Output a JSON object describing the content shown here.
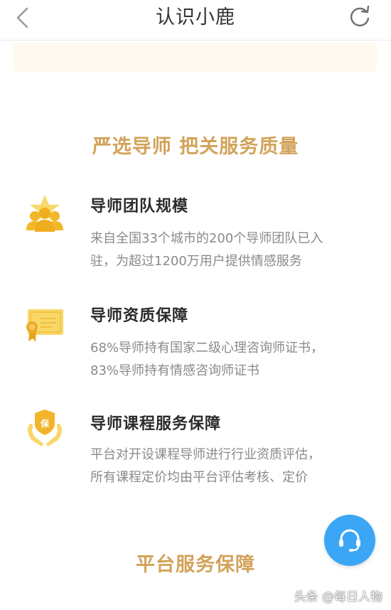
{
  "header": {
    "title": "认识小鹿",
    "back_icon": "chevron-left-icon",
    "refresh_icon": "refresh-icon"
  },
  "section1": {
    "heading": "严选导师 把关服务质量"
  },
  "features": [
    {
      "icon": "team-star-icon",
      "title": "导师团队规模",
      "desc_lines": [
        "来自全国33个城市的200个导师团队已入",
        "驻，为超过1200万用户提供情感服务"
      ]
    },
    {
      "icon": "certificate-icon",
      "title": "导师资质保障",
      "desc_lines": [
        "68%导师持有国家二级心理咨询师证书，",
        "83%导师持有情感咨询师证书"
      ]
    },
    {
      "icon": "protection-shield-icon",
      "shield_text": "保",
      "title": "导师课程服务保障",
      "desc_lines": [
        "平台对开设课程导师进行行业资质评估，",
        "所有课程定价均由平台评估考核、定价"
      ]
    }
  ],
  "section2": {
    "heading": "平台服务保障"
  },
  "support": {
    "icon": "headset-icon"
  },
  "watermark": "头条 @每日人物",
  "colors": {
    "accent_gold": "#d2a35a",
    "icon_yellow": "#f5c63a",
    "support_blue": "#3aa6f5",
    "banner_bg": "#fefaef"
  }
}
